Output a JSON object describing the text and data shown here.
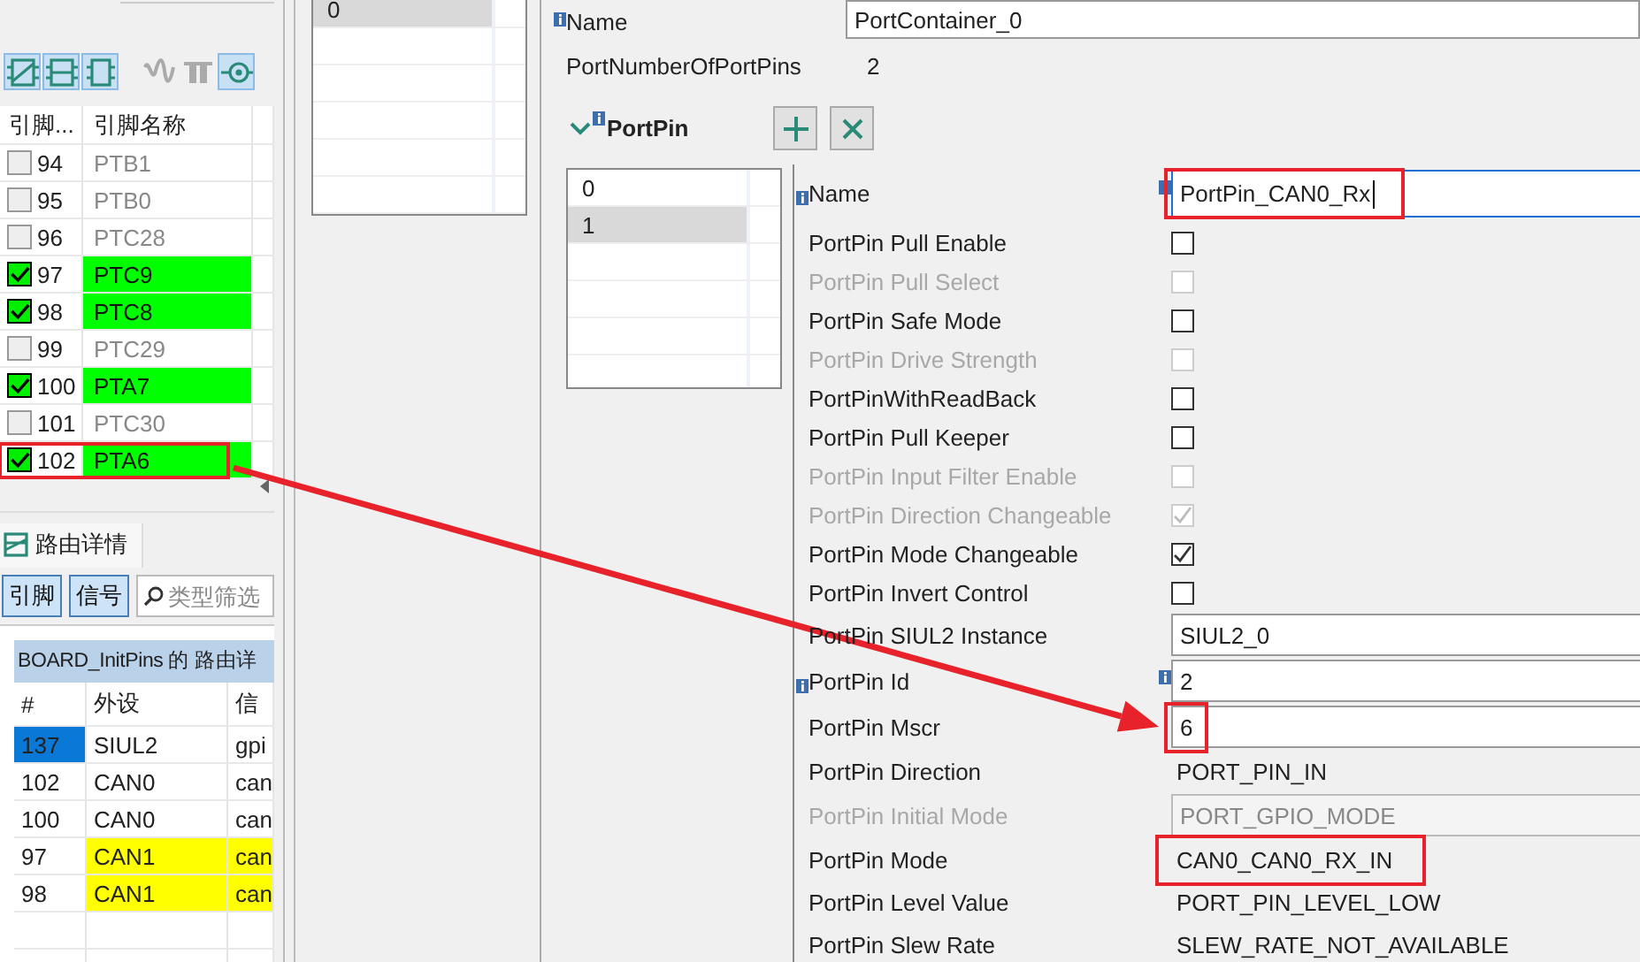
{
  "pin_panel": {
    "toolbar": [
      {
        "kind": "chip-stripe",
        "selected": true
      },
      {
        "kind": "chip-rows",
        "selected": true
      },
      {
        "kind": "chip",
        "selected": true
      },
      {
        "kind": "wave",
        "selected": false
      },
      {
        "kind": "pulse",
        "selected": false
      },
      {
        "kind": "target",
        "selected": true
      }
    ],
    "columns": [
      "引脚...",
      "引脚名称"
    ],
    "pins": [
      {
        "number": "94",
        "name": "PTB1",
        "checked": false,
        "highlighted": false
      },
      {
        "number": "95",
        "name": "PTB0",
        "checked": false,
        "highlighted": false
      },
      {
        "number": "96",
        "name": "PTC28",
        "checked": false,
        "highlighted": false
      },
      {
        "number": "97",
        "name": "PTC9",
        "checked": true,
        "highlighted": false
      },
      {
        "number": "98",
        "name": "PTC8",
        "checked": true,
        "highlighted": false
      },
      {
        "number": "99",
        "name": "PTC29",
        "checked": false,
        "highlighted": false
      },
      {
        "number": "100",
        "name": "PTA7",
        "checked": true,
        "highlighted": false
      },
      {
        "number": "101",
        "name": "PTC30",
        "checked": false,
        "highlighted": false
      },
      {
        "number": "102",
        "name": "PTA6",
        "checked": true,
        "highlighted": true
      }
    ]
  },
  "routing_panel": {
    "tab": "路由详情",
    "buttons": [
      "引脚",
      "信号"
    ],
    "search": {
      "placeholder": "类型筛选"
    },
    "table_title": "BOARD_InitPins 的 路由详",
    "columns": [
      "#",
      "外设",
      "信"
    ],
    "rows": [
      {
        "number": "137",
        "peripheral": "SIUL2",
        "signal": "gpi",
        "selected": true,
        "marked": false
      },
      {
        "number": "102",
        "peripheral": "CAN0",
        "signal": "can",
        "selected": false,
        "marked": false
      },
      {
        "number": "100",
        "peripheral": "CAN0",
        "signal": "can",
        "selected": false,
        "marked": false
      },
      {
        "number": "97",
        "peripheral": "CAN1",
        "signal": "can",
        "selected": false,
        "marked": true
      },
      {
        "number": "98",
        "peripheral": "CAN1",
        "signal": "can",
        "selected": false,
        "marked": true
      }
    ]
  },
  "container_list": [
    {
      "label": "0",
      "selected": true
    }
  ],
  "container": {
    "name_label": "Name",
    "name_value": "PortContainer_0",
    "count_label": "PortNumberOfPortPins",
    "count_value": "2"
  },
  "port_pin": {
    "title": "PortPin",
    "expanded": true,
    "items": [
      {
        "label": "0",
        "selected": false
      },
      {
        "label": "1",
        "selected": true
      }
    ]
  },
  "properties": [
    {
      "kind": "field",
      "label": "Name",
      "info": true,
      "field_info": true,
      "value": "PortPin_CAN0_Rx",
      "disabled": false,
      "focused": true,
      "highlighted": true
    },
    {
      "kind": "checkbox",
      "label": "PortPin Pull Enable",
      "checked": false,
      "disabled": false
    },
    {
      "kind": "checkbox",
      "label": "PortPin Pull Select",
      "checked": false,
      "disabled": true
    },
    {
      "kind": "checkbox",
      "label": "PortPin Safe Mode",
      "checked": false,
      "disabled": false
    },
    {
      "kind": "checkbox",
      "label": "PortPin Drive Strength",
      "checked": false,
      "disabled": true
    },
    {
      "kind": "checkbox",
      "label": "PortPinWithReadBack",
      "checked": false,
      "disabled": false
    },
    {
      "kind": "checkbox",
      "label": "PortPin Pull Keeper",
      "checked": false,
      "disabled": false
    },
    {
      "kind": "checkbox",
      "label": "PortPin Input Filter Enable",
      "checked": false,
      "disabled": true
    },
    {
      "kind": "checkbox",
      "label": "PortPin Direction Changeable",
      "checked": true,
      "disabled": true
    },
    {
      "kind": "checkbox",
      "label": "PortPin Mode Changeable",
      "checked": true,
      "disabled": false
    },
    {
      "kind": "checkbox",
      "label": "PortPin Invert Control",
      "checked": false,
      "disabled": false
    },
    {
      "kind": "field",
      "label": "PortPin SIUL2 Instance",
      "info": false,
      "field_info": false,
      "value": "SIUL2_0",
      "disabled": false,
      "focused": false,
      "highlighted": false
    },
    {
      "kind": "field",
      "label": "PortPin Id",
      "info": true,
      "field_info": true,
      "value": "2",
      "disabled": false,
      "focused": false,
      "highlighted": false
    },
    {
      "kind": "field",
      "label": "PortPin Mscr",
      "info": false,
      "field_info": false,
      "value": "6",
      "disabled": false,
      "focused": false,
      "highlighted": true
    },
    {
      "kind": "text",
      "label": "PortPin Direction",
      "value": "PORT_PIN_IN",
      "disabled": false,
      "highlighted": false
    },
    {
      "kind": "field",
      "label": "PortPin Initial Mode",
      "info": false,
      "field_info": false,
      "value": "PORT_GPIO_MODE",
      "disabled": true,
      "focused": false,
      "highlighted": false
    },
    {
      "kind": "text",
      "label": "PortPin Mode",
      "value": "CAN0_CAN0_RX_IN",
      "disabled": false,
      "highlighted": true
    },
    {
      "kind": "text",
      "label": "PortPin Level Value",
      "value": "PORT_PIN_LEVEL_LOW",
      "disabled": false,
      "highlighted": false
    },
    {
      "kind": "text",
      "label": "PortPin Slew Rate",
      "value": "SLEW_RATE_NOT_AVAILABLE",
      "disabled": false,
      "highlighted": false
    }
  ]
}
